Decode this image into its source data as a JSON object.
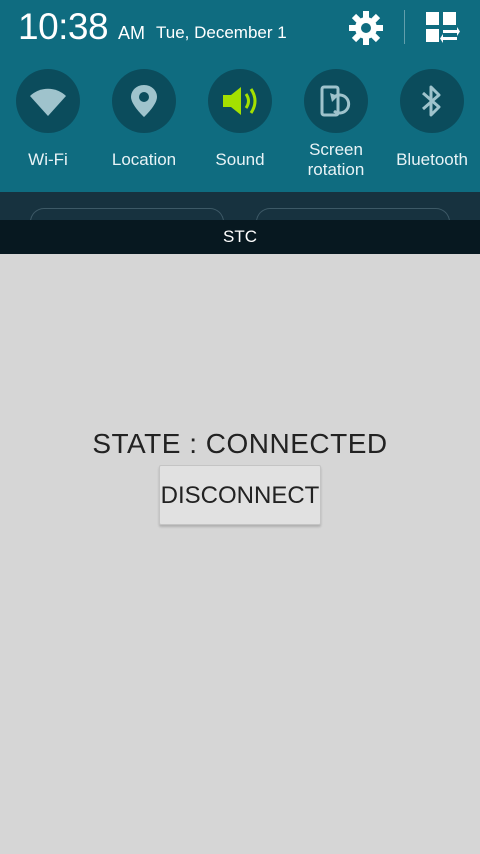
{
  "status_bar": {
    "time": "10:38",
    "ampm": "AM",
    "date": "Tue, December 1",
    "icons": [
      "gear-icon",
      "quick-panel-edit-icon"
    ]
  },
  "quick_toggles": [
    {
      "label": "Wi-Fi",
      "icon": "wifi-icon",
      "active": false
    },
    {
      "label": "Location",
      "icon": "location-icon",
      "active": false
    },
    {
      "label": "Sound",
      "icon": "sound-icon",
      "active": true
    },
    {
      "label_line1": "Screen",
      "label_line2": "rotation",
      "icon": "screen-rotation-icon",
      "active": false
    },
    {
      "label": "Bluetooth",
      "icon": "bluetooth-icon",
      "active": false
    }
  ],
  "carrier": "STC",
  "main": {
    "state_text": "STATE : CONNECTED",
    "button_label": "DISCONNECT"
  },
  "colors": {
    "shade_bg": "#0f6c80",
    "toggle_circle": "#0b4c5c",
    "active_icon": "#a4e000",
    "inactive_icon": "#9fc3cc",
    "app_bg": "#d6d6d6"
  }
}
